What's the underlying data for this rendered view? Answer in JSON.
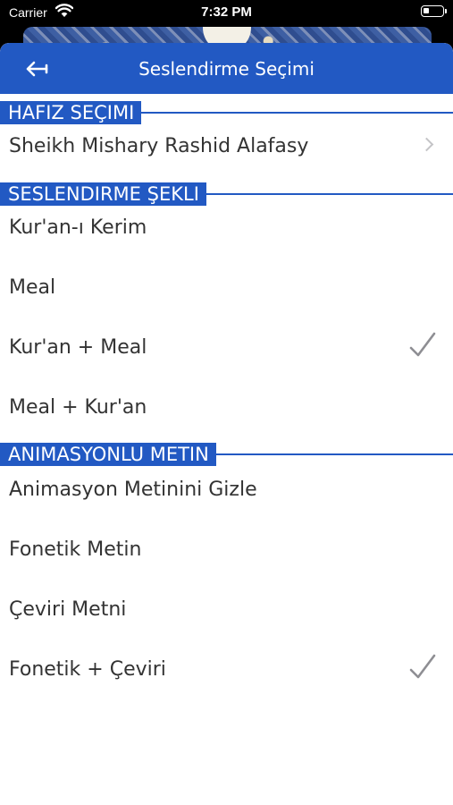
{
  "status_bar": {
    "carrier": "Carrier",
    "time": "7:32 PM"
  },
  "navbar": {
    "title": "Seslendirme Seçimi",
    "back_icon": "arrow-left-icon"
  },
  "sections": {
    "reciter": {
      "header": "HAFIZ SEÇIMI",
      "selected_reciter": "Sheikh Mishary Rashid Alafasy"
    },
    "recitation_mode": {
      "header": "SESLENDIRME ŞEKLI",
      "options": [
        "Kur'an-ı Kerim",
        "Meal",
        "Kur'an + Meal",
        "Meal + Kur'an"
      ],
      "selected": "Kur'an + Meal"
    },
    "animated_text": {
      "header": "ANIMASYONLU METIN",
      "options": [
        "Animasyon Metinini Gizle",
        "Fonetik Metin",
        "Çeviri Metni",
        "Fonetik + Çeviri"
      ],
      "selected": "Fonetik + Çeviri"
    }
  },
  "colors": {
    "accent": "#2259c3",
    "checkmark": "#8e8e93",
    "chevron": "#c4c4c7",
    "text": "#333333"
  }
}
